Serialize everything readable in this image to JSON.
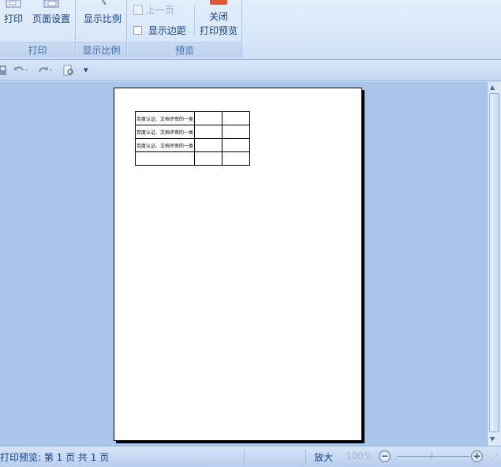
{
  "ribbon": {
    "groups": {
      "print": {
        "label": "打印",
        "print_button": "打印",
        "page_setup_button": "页面设置"
      },
      "zoom": {
        "label": "显示比例",
        "zoom_button": "显示比例"
      },
      "preview": {
        "label": "预览",
        "prev_page": "上一页",
        "show_margins": "显示边距",
        "close_line1": "关闭",
        "close_line2": "打印预览"
      }
    }
  },
  "qat": {
    "customize_symbol": "▾"
  },
  "document": {
    "table_rows": [
      [
        "百度认证、文档评审的一类",
        "",
        ""
      ],
      [
        "百度认证、文档评审的一类",
        "",
        ""
      ],
      [
        "百度认证、文档评审的一类",
        "",
        ""
      ],
      [
        "",
        "",
        ""
      ]
    ]
  },
  "status": {
    "text": "打印预览: 第 1 页  共 1 页",
    "zoom_in_label": "放大",
    "zoom_level": "100%",
    "zoom_out_symbol": "−",
    "zoom_in_symbol": "+"
  },
  "colors": {
    "accent": "#15428b",
    "preview_bg": "#a9c5ea",
    "close_icon": "#e0573a"
  }
}
